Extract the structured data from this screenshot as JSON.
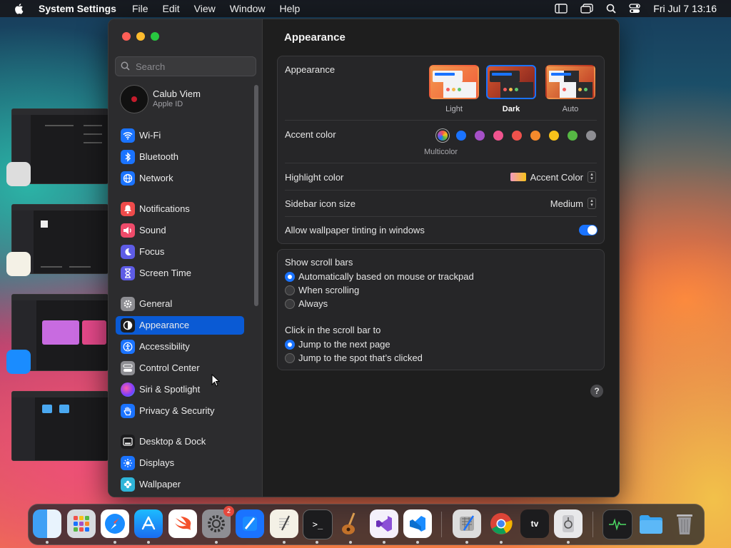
{
  "menubar": {
    "app_name": "System Settings",
    "menus": [
      "File",
      "Edit",
      "View",
      "Window",
      "Help"
    ],
    "clock": "Fri Jul 7  13:16"
  },
  "search": {
    "placeholder": "Search"
  },
  "user": {
    "name": "Calub Viem",
    "subtitle": "Apple ID"
  },
  "sidebar": {
    "items": [
      {
        "label": "Wi-Fi",
        "icon": "wifi-icon",
        "color": "#1a73ff"
      },
      {
        "label": "Bluetooth",
        "icon": "bluetooth-icon",
        "color": "#1a73ff"
      },
      {
        "label": "Network",
        "icon": "globe-icon",
        "color": "#1a73ff"
      },
      {
        "label": "Notifications",
        "icon": "bell-icon",
        "color": "#ef4b4b"
      },
      {
        "label": "Sound",
        "icon": "speaker-icon",
        "color": "#ef4b6a"
      },
      {
        "label": "Focus",
        "icon": "moon-icon",
        "color": "#5e5ce6"
      },
      {
        "label": "Screen Time",
        "icon": "hourglass-icon",
        "color": "#5e5ce6"
      },
      {
        "label": "General",
        "icon": "gear-icon",
        "color": "#8e8e93"
      },
      {
        "label": "Appearance",
        "icon": "appearance-icon",
        "color": "#1c1c1e"
      },
      {
        "label": "Accessibility",
        "icon": "accessibility-icon",
        "color": "#1a73ff"
      },
      {
        "label": "Control Center",
        "icon": "control-center-icon",
        "color": "#8e8e93"
      },
      {
        "label": "Siri & Spotlight",
        "icon": "siri-icon",
        "color": "#b04cd6"
      },
      {
        "label": "Privacy & Security",
        "icon": "hand-icon",
        "color": "#1a73ff"
      },
      {
        "label": "Desktop & Dock",
        "icon": "dock-icon",
        "color": "#1c1c1e"
      },
      {
        "label": "Displays",
        "icon": "sun-icon",
        "color": "#1a73ff"
      },
      {
        "label": "Wallpaper",
        "icon": "flower-icon",
        "color": "#2fb5d9"
      }
    ],
    "active": "Appearance"
  },
  "main": {
    "title": "Appearance",
    "appearance_label": "Appearance",
    "themes": [
      {
        "label": "Light",
        "selected": false
      },
      {
        "label": "Dark",
        "selected": true
      },
      {
        "label": "Auto",
        "selected": false
      }
    ],
    "accent_label": "Accent color",
    "accent_colors": [
      "multicolor",
      "#1a73ff",
      "#a550c7",
      "#f0548e",
      "#f0524c",
      "#f58a2c",
      "#f7c21a",
      "#56b844",
      "#8e8e93"
    ],
    "accent_selected_name": "Multicolor",
    "highlight_label": "Highlight color",
    "highlight_value": "Accent Color",
    "icon_size_label": "Sidebar icon size",
    "icon_size_value": "Medium",
    "tinting_label": "Allow wallpaper tinting in windows",
    "tinting_on": true,
    "scroll_bars_label": "Show scroll bars",
    "scroll_bar_options": [
      {
        "label": "Automatically based on mouse or trackpad",
        "selected": true
      },
      {
        "label": "When scrolling",
        "selected": false
      },
      {
        "label": "Always",
        "selected": false
      }
    ],
    "click_label": "Click in the scroll bar to",
    "click_options": [
      {
        "label": "Jump to the next page",
        "selected": true
      },
      {
        "label": "Jump to the spot that’s clicked",
        "selected": false
      }
    ],
    "help": "?"
  },
  "dock": {
    "apps": [
      "Finder",
      "Launchpad",
      "Safari",
      "App Store",
      "Swift Playgrounds",
      "System Settings",
      "Xcode",
      "TextEdit",
      "Terminal",
      "Instruments",
      "Visual Studio",
      "Visual Studio Code",
      "Simulator",
      "Google Chrome",
      "Apple TV",
      "Disk Utility",
      "Activity Monitor",
      "Downloads",
      "Trash"
    ],
    "settings_badge": "2"
  }
}
